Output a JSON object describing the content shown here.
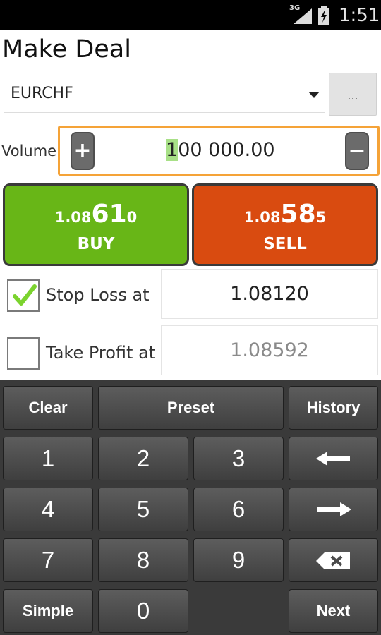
{
  "status_bar": {
    "network": "3G",
    "time": "1:51"
  },
  "title": "Make Deal",
  "symbol": {
    "value": "EURCHF",
    "more_label": "..."
  },
  "volume": {
    "label": "Volume",
    "value_highlight": "1",
    "value_rest": "00 000.00",
    "plus_label": "+",
    "minus_label": "−"
  },
  "buy": {
    "price_small": "1.08",
    "price_big": "61",
    "price_pip": "0",
    "label": "BUY",
    "color": "#68b617"
  },
  "sell": {
    "price_small": "1.08",
    "price_big": "58",
    "price_pip": "5",
    "label": "SELL",
    "color": "#d94b10"
  },
  "stop_loss": {
    "label": "Stop Loss at",
    "value": "1.08120",
    "checked": true
  },
  "take_profit": {
    "label": "Take Profit at",
    "value": "1.08592",
    "checked": false
  },
  "keyboard": {
    "clear": "Clear",
    "preset": "Preset",
    "history": "History",
    "digits": [
      "1",
      "2",
      "3",
      "4",
      "5",
      "6",
      "7",
      "8",
      "9",
      "0"
    ],
    "simple": "Simple",
    "next": "Next",
    "icons": {
      "left": "arrow-left-icon",
      "right": "arrow-right-icon",
      "backspace": "backspace-icon"
    }
  },
  "colors": {
    "accent": "#f5a338",
    "highlight": "#a8e087"
  }
}
